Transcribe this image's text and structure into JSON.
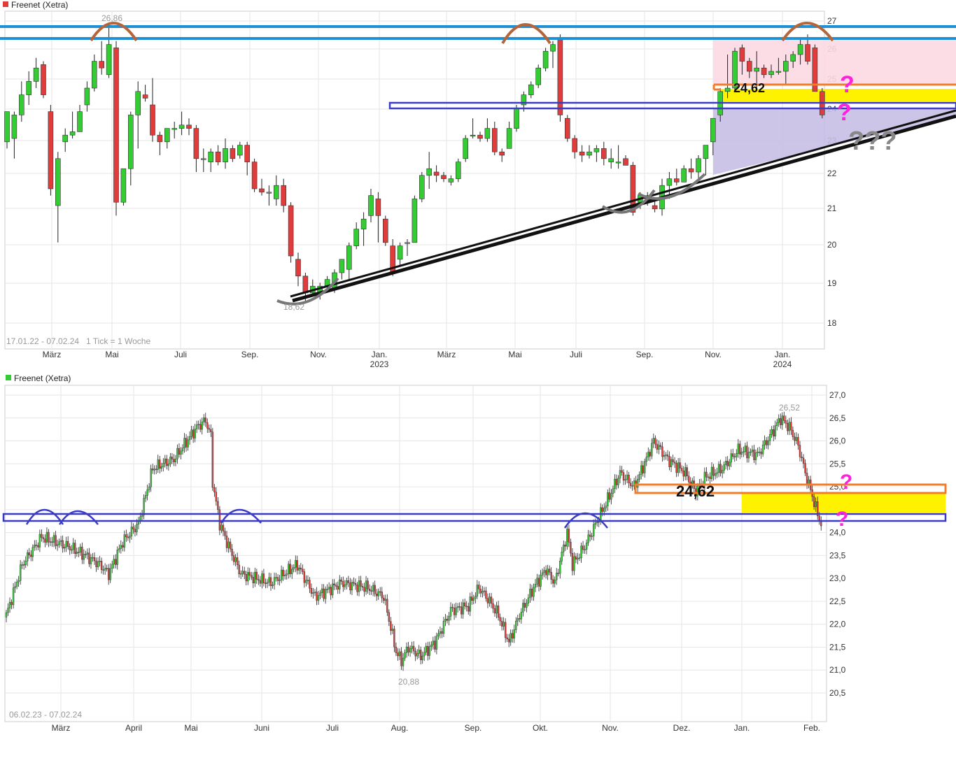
{
  "chart_data": [
    {
      "type": "candlestick",
      "title": "Freenet (Xetra)",
      "legend_color": "#e03c3c",
      "date_range_label": "17.01.22 - 07.02.24",
      "tick_info": "1 Tick = 1 Woche",
      "ylim": [
        17.6,
        27.3
      ],
      "y_ticks": [
        "18",
        "19",
        "20",
        "21",
        "22",
        "23",
        "24",
        "25",
        "26",
        "27"
      ],
      "x_tick_labels": [
        "März",
        "Mai",
        "Juli",
        "Sep.",
        "Nov.",
        "Jan.",
        "März",
        "Mai",
        "Juli",
        "Sep.",
        "Nov.",
        "Jan."
      ],
      "year_labels": [
        "2023",
        "2024"
      ],
      "high_label": "26,86",
      "low_label": "18,62",
      "annotation_value": "24,62",
      "question_marks": [
        "?",
        "?",
        "???"
      ],
      "candles": [
        {
          "o": 23.4,
          "h": 24.3,
          "l": 23.2,
          "c": 24.3
        },
        {
          "o": 23.5,
          "h": 24.3,
          "l": 22.9,
          "c": 24.2
        },
        {
          "o": 24.2,
          "h": 25.2,
          "l": 24.0,
          "c": 24.8
        },
        {
          "o": 24.8,
          "h": 25.5,
          "l": 24.5,
          "c": 25.2
        },
        {
          "o": 25.2,
          "h": 25.9,
          "l": 25.0,
          "c": 25.6
        },
        {
          "o": 25.7,
          "h": 25.8,
          "l": 24.7,
          "c": 24.8
        },
        {
          "o": 24.3,
          "h": 24.5,
          "l": 21.8,
          "c": 22.0
        },
        {
          "o": 21.5,
          "h": 23.1,
          "l": 20.4,
          "c": 22.9
        },
        {
          "o": 23.4,
          "h": 23.8,
          "l": 23.1,
          "c": 23.6
        },
        {
          "o": 23.6,
          "h": 24.3,
          "l": 23.5,
          "c": 23.7
        },
        {
          "o": 23.7,
          "h": 24.5,
          "l": 23.7,
          "c": 24.3
        },
        {
          "o": 24.5,
          "h": 25.2,
          "l": 24.3,
          "c": 25.0
        },
        {
          "o": 25.0,
          "h": 26.0,
          "l": 24.9,
          "c": 25.8
        },
        {
          "o": 25.8,
          "h": 26.4,
          "l": 25.4,
          "c": 25.6
        },
        {
          "o": 25.4,
          "h": 26.86,
          "l": 25.3,
          "c": 26.3
        },
        {
          "o": 26.2,
          "h": 26.4,
          "l": 21.2,
          "c": 21.6
        },
        {
          "o": 21.6,
          "h": 22.6,
          "l": 21.5,
          "c": 22.6
        },
        {
          "o": 22.6,
          "h": 24.3,
          "l": 22.1,
          "c": 24.2
        },
        {
          "o": 24.2,
          "h": 25.2,
          "l": 23.2,
          "c": 24.9
        },
        {
          "o": 24.8,
          "h": 25.1,
          "l": 24.6,
          "c": 24.7
        },
        {
          "o": 24.5,
          "h": 25.3,
          "l": 23.4,
          "c": 23.6
        },
        {
          "o": 23.6,
          "h": 23.7,
          "l": 23.0,
          "c": 23.4
        },
        {
          "o": 23.4,
          "h": 23.8,
          "l": 23.2,
          "c": 23.8
        },
        {
          "o": 23.8,
          "h": 24.0,
          "l": 23.5,
          "c": 23.8
        },
        {
          "o": 23.8,
          "h": 24.3,
          "l": 23.6,
          "c": 23.9
        },
        {
          "o": 23.9,
          "h": 24.1,
          "l": 23.6,
          "c": 23.8
        },
        {
          "o": 23.8,
          "h": 23.9,
          "l": 22.5,
          "c": 22.9
        },
        {
          "o": 22.9,
          "h": 23.2,
          "l": 22.5,
          "c": 22.9
        },
        {
          "o": 22.8,
          "h": 23.2,
          "l": 22.5,
          "c": 23.1
        },
        {
          "o": 23.1,
          "h": 23.3,
          "l": 22.7,
          "c": 22.8
        },
        {
          "o": 22.8,
          "h": 23.5,
          "l": 22.6,
          "c": 23.2
        },
        {
          "o": 23.2,
          "h": 23.3,
          "l": 22.8,
          "c": 22.9
        },
        {
          "o": 23.0,
          "h": 23.4,
          "l": 22.9,
          "c": 23.3
        },
        {
          "o": 23.3,
          "h": 23.4,
          "l": 22.4,
          "c": 22.8
        },
        {
          "o": 22.8,
          "h": 22.9,
          "l": 21.9,
          "c": 22.0
        },
        {
          "o": 22.0,
          "h": 22.3,
          "l": 21.8,
          "c": 21.9
        },
        {
          "o": 21.9,
          "h": 22.1,
          "l": 21.5,
          "c": 21.9
        },
        {
          "o": 21.7,
          "h": 22.4,
          "l": 21.5,
          "c": 22.1
        },
        {
          "o": 22.1,
          "h": 22.3,
          "l": 21.3,
          "c": 21.5
        },
        {
          "o": 21.5,
          "h": 21.6,
          "l": 19.8,
          "c": 20.0
        },
        {
          "o": 19.9,
          "h": 20.1,
          "l": 19.1,
          "c": 19.4
        },
        {
          "o": 19.4,
          "h": 19.5,
          "l": 18.62,
          "c": 18.9
        },
        {
          "o": 18.9,
          "h": 19.3,
          "l": 18.8,
          "c": 19.1
        },
        {
          "o": 18.9,
          "h": 19.2,
          "l": 18.7,
          "c": 19.1
        },
        {
          "o": 19.1,
          "h": 19.4,
          "l": 18.9,
          "c": 19.3
        },
        {
          "o": 19.0,
          "h": 19.6,
          "l": 18.9,
          "c": 19.5
        },
        {
          "o": 19.5,
          "h": 19.9,
          "l": 19.3,
          "c": 19.9
        },
        {
          "o": 19.6,
          "h": 20.4,
          "l": 19.3,
          "c": 20.3
        },
        {
          "o": 20.3,
          "h": 21.0,
          "l": 20.2,
          "c": 20.8
        },
        {
          "o": 20.8,
          "h": 21.3,
          "l": 20.3,
          "c": 21.1
        },
        {
          "o": 21.2,
          "h": 22.0,
          "l": 21.0,
          "c": 21.8
        },
        {
          "o": 21.7,
          "h": 21.9,
          "l": 20.4,
          "c": 21.2
        },
        {
          "o": 21.1,
          "h": 21.2,
          "l": 20.3,
          "c": 20.4
        },
        {
          "o": 20.3,
          "h": 20.5,
          "l": 19.4,
          "c": 19.5
        },
        {
          "o": 19.9,
          "h": 20.4,
          "l": 19.7,
          "c": 20.3
        },
        {
          "o": 20.4,
          "h": 20.5,
          "l": 20.0,
          "c": 20.4
        },
        {
          "o": 20.4,
          "h": 21.8,
          "l": 20.4,
          "c": 21.7
        },
        {
          "o": 21.7,
          "h": 22.5,
          "l": 21.6,
          "c": 22.4
        },
        {
          "o": 22.4,
          "h": 23.1,
          "l": 22.0,
          "c": 22.6
        },
        {
          "o": 22.5,
          "h": 22.7,
          "l": 22.2,
          "c": 22.4
        },
        {
          "o": 22.4,
          "h": 22.5,
          "l": 22.2,
          "c": 22.3
        },
        {
          "o": 22.2,
          "h": 22.4,
          "l": 22.1,
          "c": 22.3
        },
        {
          "o": 22.3,
          "h": 22.9,
          "l": 22.2,
          "c": 22.8
        },
        {
          "o": 22.9,
          "h": 23.6,
          "l": 22.8,
          "c": 23.5
        },
        {
          "o": 23.6,
          "h": 24.1,
          "l": 23.5,
          "c": 23.6
        },
        {
          "o": 23.6,
          "h": 23.7,
          "l": 23.4,
          "c": 23.5
        },
        {
          "o": 23.5,
          "h": 24.1,
          "l": 23.4,
          "c": 23.8
        },
        {
          "o": 23.8,
          "h": 24.0,
          "l": 23.0,
          "c": 23.1
        },
        {
          "o": 23.1,
          "h": 23.2,
          "l": 22.8,
          "c": 23.0
        },
        {
          "o": 23.2,
          "h": 24.0,
          "l": 23.2,
          "c": 23.8
        },
        {
          "o": 23.8,
          "h": 24.5,
          "l": 23.7,
          "c": 24.4
        },
        {
          "o": 24.5,
          "h": 24.9,
          "l": 24.3,
          "c": 24.8
        },
        {
          "o": 24.8,
          "h": 25.2,
          "l": 24.7,
          "c": 25.1
        },
        {
          "o": 25.1,
          "h": 25.7,
          "l": 25.0,
          "c": 25.6
        },
        {
          "o": 25.6,
          "h": 26.2,
          "l": 25.5,
          "c": 26.1
        },
        {
          "o": 26.1,
          "h": 26.4,
          "l": 25.6,
          "c": 26.3
        },
        {
          "o": 26.5,
          "h": 26.6,
          "l": 24.0,
          "c": 24.2
        },
        {
          "o": 24.1,
          "h": 24.2,
          "l": 23.4,
          "c": 23.5
        },
        {
          "o": 23.5,
          "h": 23.6,
          "l": 22.9,
          "c": 23.1
        },
        {
          "o": 23.1,
          "h": 23.3,
          "l": 22.8,
          "c": 23.0
        },
        {
          "o": 23.0,
          "h": 23.3,
          "l": 22.9,
          "c": 23.1
        },
        {
          "o": 23.1,
          "h": 23.3,
          "l": 22.8,
          "c": 23.2
        },
        {
          "o": 23.2,
          "h": 23.4,
          "l": 22.7,
          "c": 22.9
        },
        {
          "o": 22.8,
          "h": 23.2,
          "l": 22.6,
          "c": 22.9
        },
        {
          "o": 22.8,
          "h": 23.3,
          "l": 22.6,
          "c": 22.8
        },
        {
          "o": 22.9,
          "h": 23.0,
          "l": 22.7,
          "c": 22.7
        },
        {
          "o": 22.7,
          "h": 22.8,
          "l": 21.2,
          "c": 21.3
        },
        {
          "o": 21.6,
          "h": 21.9,
          "l": 21.4,
          "c": 21.8
        },
        {
          "o": 21.8,
          "h": 21.9,
          "l": 21.5,
          "c": 21.6
        },
        {
          "o": 21.5,
          "h": 21.7,
          "l": 21.3,
          "c": 21.4
        },
        {
          "o": 21.4,
          "h": 22.3,
          "l": 21.2,
          "c": 22.1
        },
        {
          "o": 22.1,
          "h": 22.5,
          "l": 21.7,
          "c": 22.3
        },
        {
          "o": 22.3,
          "h": 22.6,
          "l": 22.1,
          "c": 22.2
        },
        {
          "o": 22.2,
          "h": 22.7,
          "l": 22.2,
          "c": 22.6
        },
        {
          "o": 22.6,
          "h": 22.9,
          "l": 22.3,
          "c": 22.5
        },
        {
          "o": 22.5,
          "h": 23.0,
          "l": 22.3,
          "c": 22.9
        },
        {
          "o": 22.9,
          "h": 23.3,
          "l": 22.4,
          "c": 23.3
        },
        {
          "o": 23.4,
          "h": 24.1,
          "l": 23.0,
          "c": 24.1
        },
        {
          "o": 24.2,
          "h": 25.0,
          "l": 24.0,
          "c": 24.9
        },
        {
          "o": 24.9,
          "h": 26.0,
          "l": 24.7,
          "c": 25.0
        },
        {
          "o": 25.0,
          "h": 26.2,
          "l": 24.9,
          "c": 26.1
        },
        {
          "o": 26.2,
          "h": 26.3,
          "l": 25.4,
          "c": 25.8
        },
        {
          "o": 25.8,
          "h": 25.9,
          "l": 25.3,
          "c": 25.5
        },
        {
          "o": 25.5,
          "h": 26.1,
          "l": 25.0,
          "c": 25.6
        },
        {
          "o": 25.6,
          "h": 25.7,
          "l": 25.3,
          "c": 25.4
        },
        {
          "o": 25.4,
          "h": 25.7,
          "l": 25.3,
          "c": 25.5
        },
        {
          "o": 25.5,
          "h": 25.9,
          "l": 25.4,
          "c": 25.5
        },
        {
          "o": 25.5,
          "h": 26.0,
          "l": 25.1,
          "c": 25.8
        },
        {
          "o": 25.8,
          "h": 26.1,
          "l": 25.6,
          "c": 26.0
        },
        {
          "o": 26.0,
          "h": 26.5,
          "l": 25.7,
          "c": 26.3
        },
        {
          "o": 26.3,
          "h": 26.6,
          "l": 25.7,
          "c": 25.8
        },
        {
          "o": 26.2,
          "h": 26.3,
          "l": 24.9,
          "c": 24.9
        },
        {
          "o": 24.9,
          "h": 25.0,
          "l": 24.1,
          "c": 24.2
        }
      ]
    },
    {
      "type": "candlestick",
      "title": "Freenet (Xetra)",
      "legend_color": "#33cc33",
      "date_range_label": "06.02.23 - 07.02.24",
      "ylim": [
        20.0,
        27.2
      ],
      "y_ticks": [
        "20,5",
        "21,0",
        "21,5",
        "22,0",
        "22,5",
        "23,0",
        "23,5",
        "24,0",
        "24,5",
        "25,0",
        "25,5",
        "26,0",
        "26,5",
        "27,0"
      ],
      "x_tick_labels": [
        "März",
        "April",
        "Mai",
        "Juni",
        "Juli",
        "Aug.",
        "Sep.",
        "Okt.",
        "Nov.",
        "Dez.",
        "Jan.",
        "Feb."
      ],
      "high_label": "26,52",
      "low_label": "20,88",
      "annotation_value": "24,62",
      "question_marks": [
        "?",
        "?"
      ],
      "anchors": [
        [
          0,
          22.2
        ],
        [
          9,
          23.3
        ],
        [
          20,
          23.9
        ],
        [
          35,
          23.7
        ],
        [
          45,
          23.5
        ],
        [
          53,
          23.3
        ],
        [
          58,
          23.1
        ],
        [
          66,
          23.8
        ],
        [
          75,
          24.2
        ],
        [
          83,
          25.4
        ],
        [
          95,
          25.6
        ],
        [
          108,
          26.3
        ],
        [
          113,
          26.45
        ],
        [
          116,
          26.1
        ],
        [
          117,
          25.1
        ],
        [
          121,
          24.2
        ],
        [
          126,
          23.7
        ],
        [
          133,
          23.1
        ],
        [
          150,
          22.9
        ],
        [
          165,
          23.3
        ],
        [
          175,
          22.6
        ],
        [
          190,
          22.9
        ],
        [
          205,
          22.8
        ],
        [
          214,
          22.6
        ],
        [
          217,
          22.1
        ],
        [
          221,
          21.4
        ],
        [
          224,
          21.2
        ],
        [
          228,
          21.5
        ],
        [
          235,
          21.3
        ],
        [
          243,
          21.6
        ],
        [
          252,
          22.3
        ],
        [
          262,
          22.4
        ],
        [
          268,
          22.8
        ],
        [
          274,
          22.5
        ],
        [
          279,
          22.2
        ],
        [
          285,
          21.6
        ],
        [
          291,
          22.2
        ],
        [
          299,
          22.8
        ],
        [
          306,
          23.2
        ],
        [
          311,
          22.9
        ],
        [
          318,
          24.0
        ],
        [
          321,
          23.3
        ],
        [
          328,
          23.7
        ],
        [
          333,
          24.1
        ],
        [
          342,
          24.8
        ],
        [
          348,
          25.3
        ],
        [
          356,
          25.0
        ],
        [
          364,
          25.7
        ],
        [
          367,
          26.0
        ],
        [
          375,
          25.6
        ],
        [
          385,
          25.3
        ],
        [
          391,
          24.9
        ],
        [
          396,
          25.2
        ],
        [
          406,
          25.4
        ],
        [
          415,
          25.8
        ],
        [
          426,
          25.7
        ],
        [
          433,
          26.1
        ],
        [
          439,
          26.5
        ],
        [
          444,
          26.3
        ],
        [
          449,
          25.9
        ],
        [
          453,
          25.3
        ],
        [
          457,
          24.8
        ],
        [
          460,
          24.4
        ],
        [
          462,
          24.2
        ]
      ]
    }
  ]
}
